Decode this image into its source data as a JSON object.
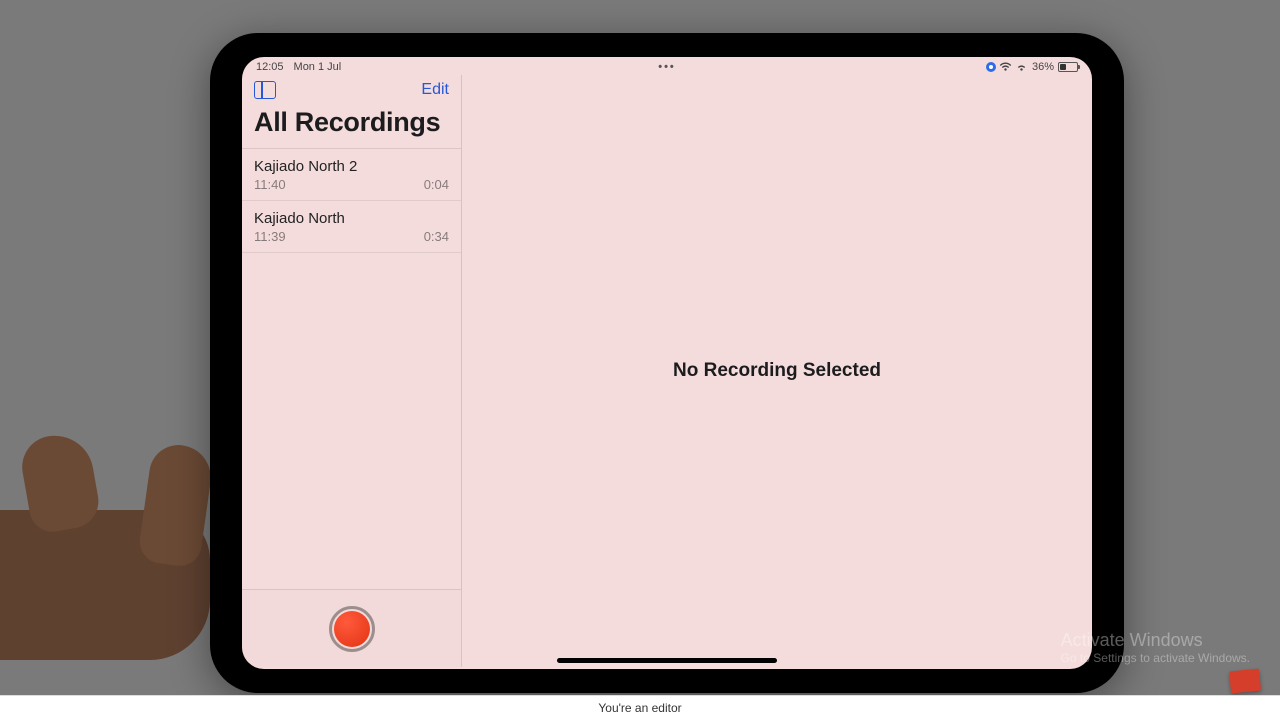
{
  "status": {
    "time": "12:05",
    "date": "Mon 1 Jul",
    "center": "•••",
    "battery_pct": "36%"
  },
  "sidebar": {
    "edit_label": "Edit",
    "title": "All Recordings"
  },
  "recordings": [
    {
      "name": "Kajiado North 2",
      "time": "11:40",
      "duration": "0:04"
    },
    {
      "name": "Kajiado North",
      "time": "11:39",
      "duration": "0:34"
    }
  ],
  "main": {
    "empty_message": "No Recording Selected"
  },
  "watermark": {
    "title": "Activate Windows",
    "subtitle": "Go to Settings to activate Windows."
  },
  "footer": {
    "text": "You're an editor"
  }
}
